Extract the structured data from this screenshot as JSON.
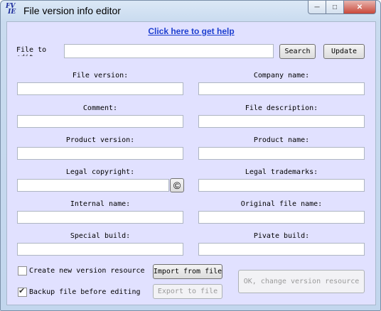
{
  "window": {
    "title": "File version info editor",
    "icon_name": "fvie-app-icon"
  },
  "help_link": "Click here to get help",
  "file_to_edit": {
    "label": "File to edit:",
    "value": ""
  },
  "buttons": {
    "search": "Search",
    "update": "Update",
    "import": "Import from file",
    "export": "Export to file",
    "change": "OK, change version resource",
    "copyright_symbol": "©"
  },
  "fields": {
    "file_version": {
      "label": "File version:",
      "value": ""
    },
    "company_name": {
      "label": "Company name:",
      "value": ""
    },
    "comment": {
      "label": "Comment:",
      "value": ""
    },
    "file_description": {
      "label": "File description:",
      "value": ""
    },
    "product_version": {
      "label": "Product version:",
      "value": ""
    },
    "product_name": {
      "label": "Product name:",
      "value": ""
    },
    "legal_copyright": {
      "label": "Legal copyright:",
      "value": ""
    },
    "legal_trademarks": {
      "label": "Legal trademarks:",
      "value": ""
    },
    "internal_name": {
      "label": "Internal name:",
      "value": ""
    },
    "original_file_name": {
      "label": "Original file name:",
      "value": ""
    },
    "special_build": {
      "label": "Special build:",
      "value": ""
    },
    "private_build": {
      "label": "Pivate build:",
      "value": ""
    }
  },
  "checkboxes": {
    "create_new": {
      "label": "Create new version resource",
      "checked": false
    },
    "backup": {
      "label": "Backup file before editing",
      "checked": true
    }
  },
  "colors": {
    "client_bg": "#e1e1ff",
    "link": "#1e3fd0"
  }
}
